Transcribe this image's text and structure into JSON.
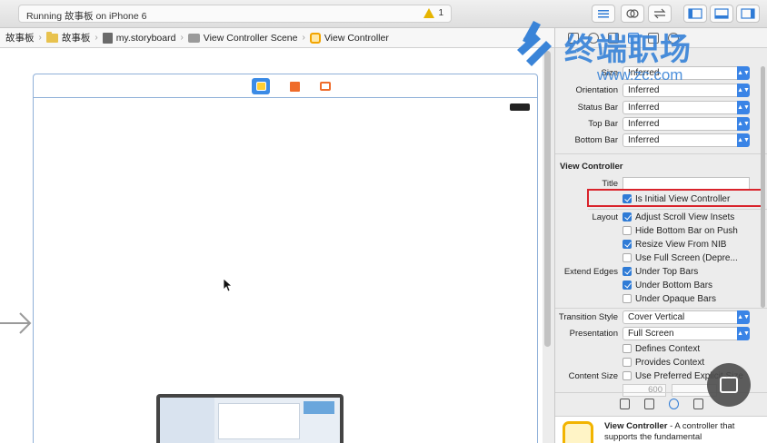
{
  "toolbar": {
    "status_text": "Running 故事板 on iPhone 6",
    "warning_count": "1"
  },
  "jumpbar": {
    "crumbs": [
      "故事板",
      "故事板",
      "my.storyboard",
      "View Controller Scene",
      "View Controller"
    ]
  },
  "watermark": {
    "title": "终端职场",
    "url": "www.zc.com"
  },
  "inspector": {
    "simulated_metrics": [
      {
        "label": "Size",
        "value": "Inferred"
      },
      {
        "label": "Orientation",
        "value": "Inferred"
      },
      {
        "label": "Status Bar",
        "value": "Inferred"
      },
      {
        "label": "Top Bar",
        "value": "Inferred"
      },
      {
        "label": "Bottom Bar",
        "value": "Inferred"
      }
    ],
    "vc_section_title": "View Controller",
    "title_label": "Title",
    "title_value": "",
    "initial_vc_label": "Is Initial View Controller",
    "layout_label": "Layout",
    "layout_options": [
      {
        "label": "Adjust Scroll View Insets",
        "checked": true
      },
      {
        "label": "Hide Bottom Bar on Push",
        "checked": false
      },
      {
        "label": "Resize View From NIB",
        "checked": true
      },
      {
        "label": "Use Full Screen (Depre...",
        "checked": false
      }
    ],
    "extend_edges_label": "Extend Edges",
    "extend_options": [
      {
        "label": "Under Top Bars",
        "checked": true
      },
      {
        "label": "Under Bottom Bars",
        "checked": true
      },
      {
        "label": "Under Opaque Bars",
        "checked": false
      }
    ],
    "transition_style_label": "Transition Style",
    "transition_style_value": "Cover Vertical",
    "presentation_label": "Presentation",
    "presentation_value": "Full Screen",
    "defines_context_label": "Defines Context",
    "provides_context_label": "Provides Context",
    "content_size_label": "Content Size",
    "use_preferred_label": "Use Preferred Explicit Size",
    "width_value": "600"
  },
  "library": {
    "item_title": "View Controller",
    "item_desc": " - A controller that supports the fundamental"
  },
  "colors": {
    "accent": "#2f7bd6",
    "highlight": "#d9232b",
    "warning": "#e6b400"
  }
}
